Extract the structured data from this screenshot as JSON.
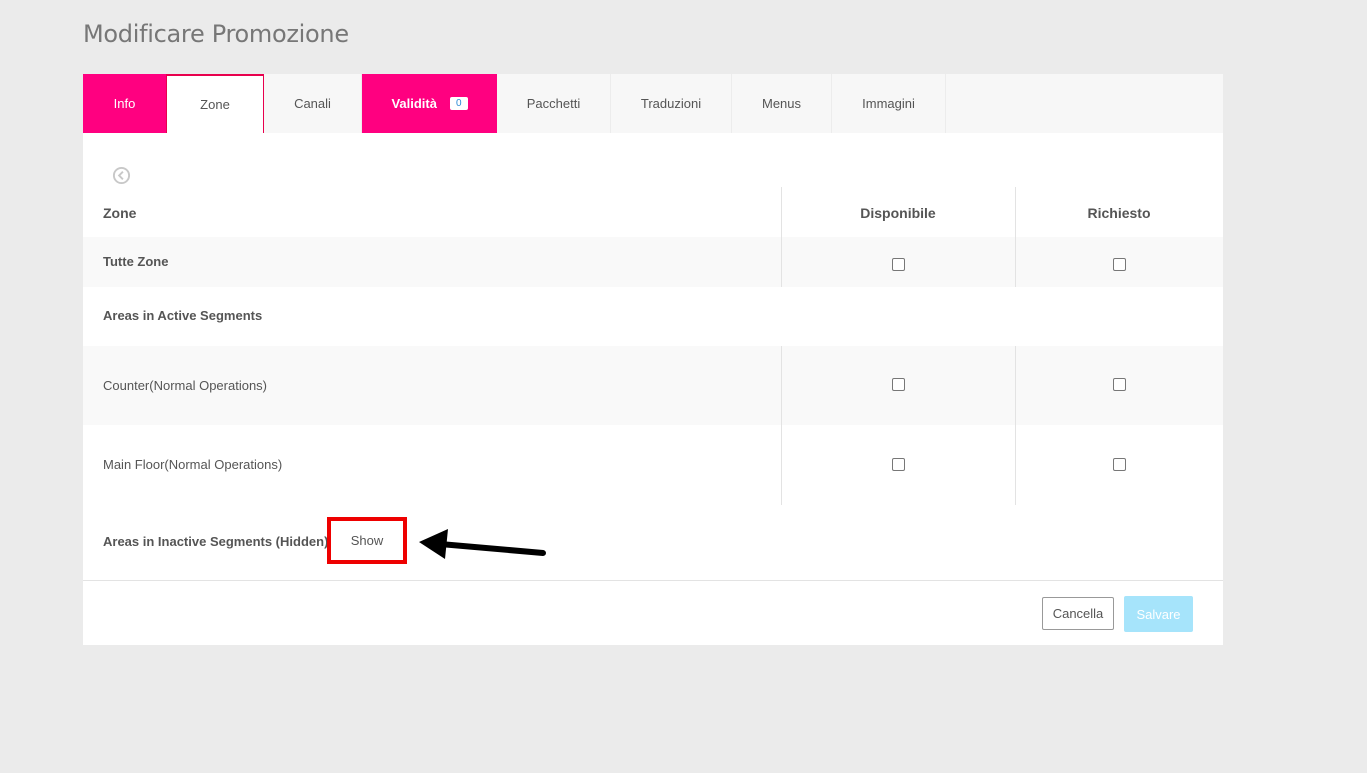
{
  "page_title": "Modificare Promozione",
  "tabs": [
    {
      "label": "Info"
    },
    {
      "label": "Zone"
    },
    {
      "label": "Canali"
    },
    {
      "label": "Validità",
      "badge": "0"
    },
    {
      "label": "Pacchetti"
    },
    {
      "label": "Traduzioni"
    },
    {
      "label": "Menus"
    },
    {
      "label": "Immagini"
    }
  ],
  "table": {
    "headers": {
      "zone": "Zone",
      "available": "Disponibile",
      "required": "Richiesto"
    },
    "all_zones": "Tutte Zone",
    "active_section": "Areas in Active Segments",
    "rows": [
      {
        "label": "Counter(Normal Operations)"
      },
      {
        "label": "Main Floor(Normal Operations)"
      }
    ],
    "inactive_section": "Areas in Inactive Segments (Hidden)",
    "show_label": "Show"
  },
  "footer": {
    "cancel_label": "Cancella",
    "save_label": "Salvare"
  },
  "colors": {
    "accent_pink": "#ff0080",
    "highlight_red": "#ee0000",
    "save_disabled": "#a6e4fb"
  },
  "icons": {
    "back": "circle-chevron-left-icon",
    "annotation": "black-arrow-icon"
  }
}
